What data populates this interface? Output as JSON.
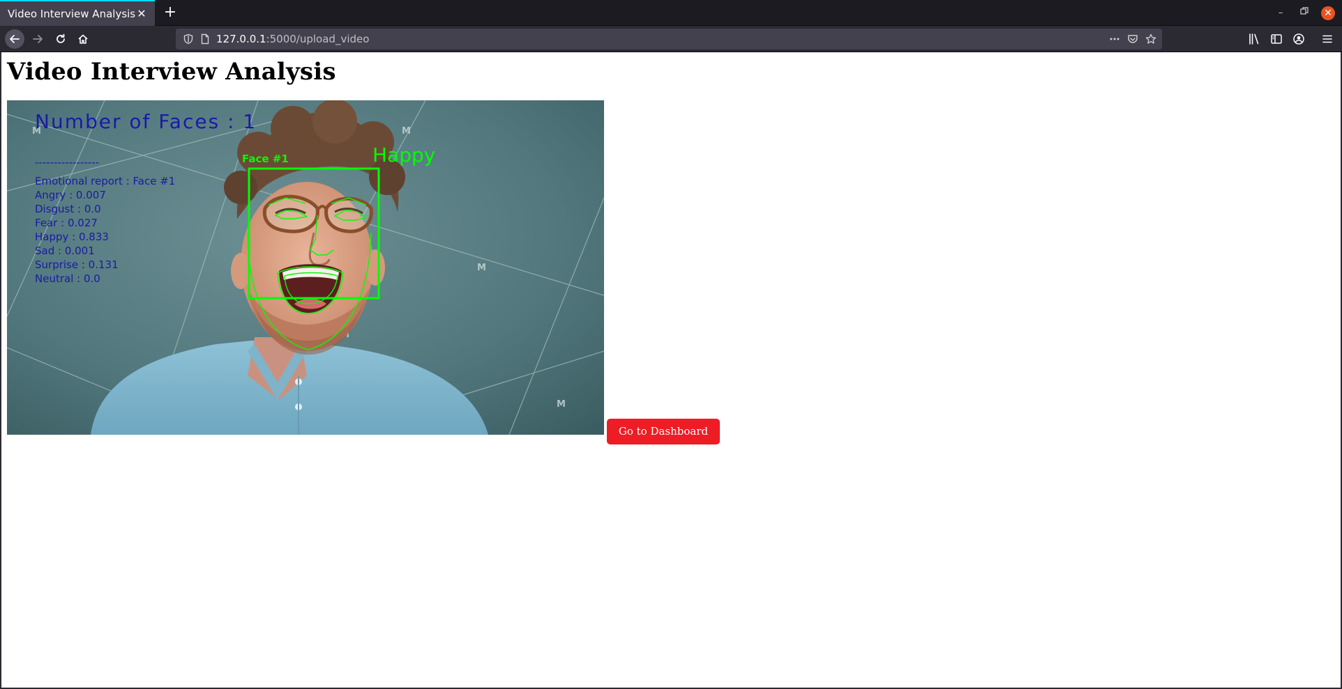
{
  "browser": {
    "tab_title": "Video Interview Analysis",
    "url_host": "127.0.0.1",
    "url_rest": ":5000/upload_video"
  },
  "page": {
    "title": "Video Interview Analysis",
    "dashboard_button": "Go to Dashboard"
  },
  "video_overlay": {
    "faces_count_text": "Number of Faces : 1",
    "separator": "-----------------",
    "face_tag": "Face #1",
    "dominant_emotion": "Happy",
    "report_title": "Emotional report : Face #1",
    "report_lines": [
      "Angry : 0.007",
      "Disgust : 0.0",
      "Fear : 0.027",
      "Happy : 0.833",
      "Sad : 0.001",
      "Surprise : 0.131",
      "Neutral : 0.0"
    ],
    "colors": {
      "overlay_green": "#00ff00",
      "report_blue": "#1a1aa8"
    }
  },
  "icons": {
    "tab_close": "close-icon",
    "new_tab": "plus-icon",
    "back": "arrow-left-icon",
    "forward": "arrow-right-icon",
    "reload": "reload-icon",
    "home": "home-icon",
    "shield": "shield-icon",
    "page": "page-icon",
    "more": "more-horizontal-icon",
    "pocket": "pocket-icon",
    "bookmark": "star-icon",
    "library": "library-icon",
    "sidebar": "sidebar-icon",
    "account": "account-icon",
    "menu": "hamburger-menu-icon"
  }
}
